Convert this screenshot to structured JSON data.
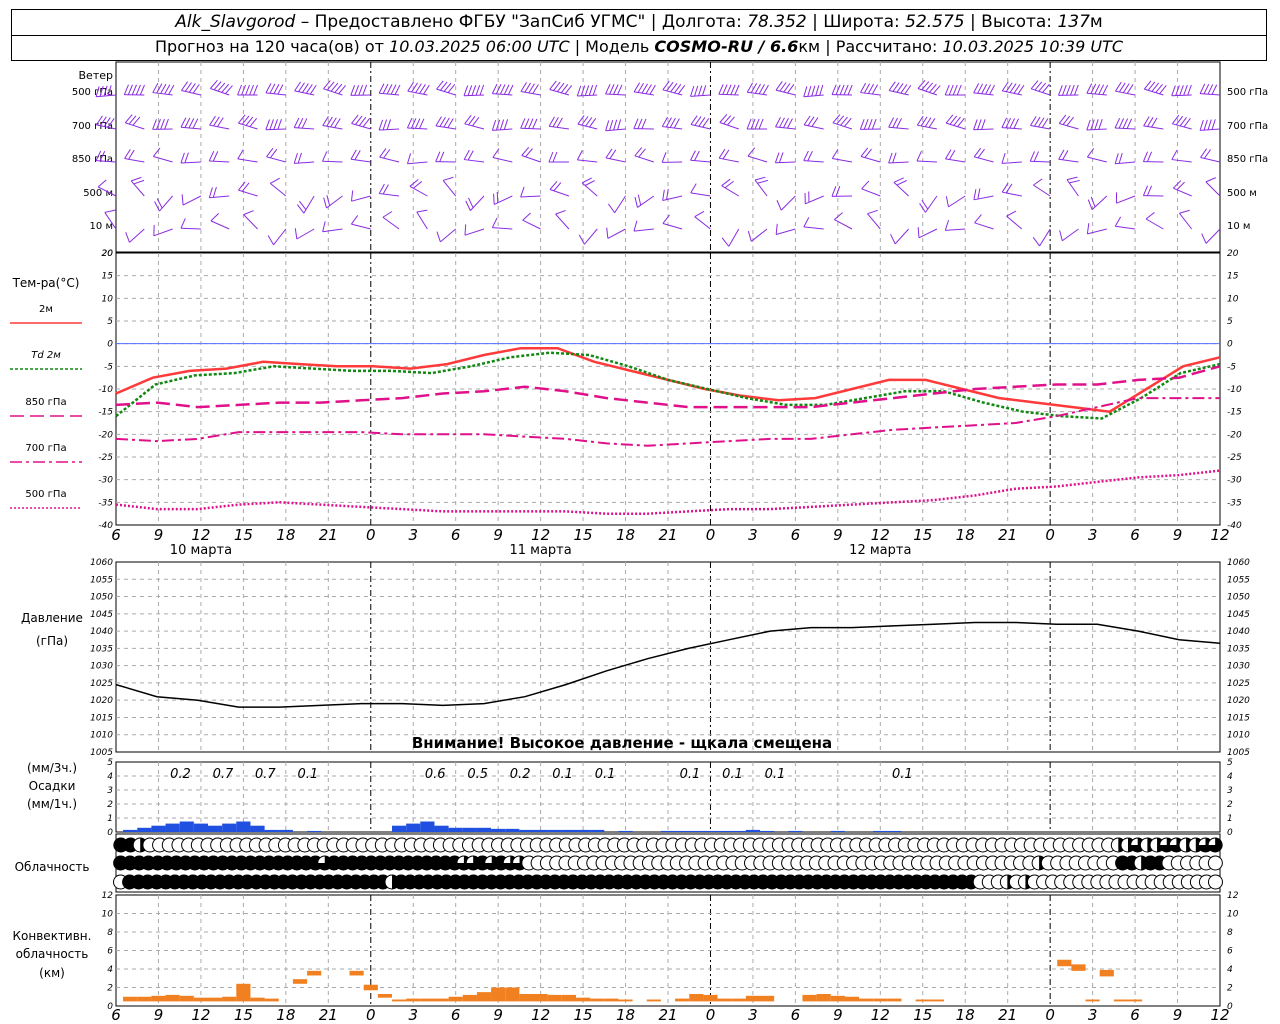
{
  "header": {
    "station": "Alk_Slavgorod",
    "provider": "Предоставлено ФГБУ \"ЗапСиб УГМС\"",
    "lon_label": "Долгота:",
    "lon": "78.352",
    "lat_label": "Широта:",
    "lat": "52.575",
    "alt_label": "Высота:",
    "alt": "137",
    "alt_unit": "м",
    "forecast_label": "Прогноз на 120 часа(ов) от",
    "forecast_time": "10.03.2025 06:00 UTC",
    "model_label": "Модель",
    "model": "COSMO-RU / 6.6",
    "model_unit": "км",
    "calc_label": "Рассчитано:",
    "calc_time": "10.03.2025 10:39 UTC"
  },
  "time_axis": {
    "hours": [
      "6",
      "9",
      "12",
      "15",
      "18",
      "21",
      "0",
      "3",
      "6",
      "9",
      "12",
      "15",
      "18",
      "21",
      "0",
      "3",
      "6",
      "9",
      "12",
      "15",
      "18",
      "21",
      "0",
      "3",
      "6",
      "9",
      "12"
    ],
    "dates": [
      "10 марта",
      "11 марта",
      "12 марта"
    ]
  },
  "wind_panel": {
    "title": "Ветер",
    "levels": [
      "500 гПа",
      "700 гПа",
      "850 гПа",
      "500 м",
      "10 м"
    ]
  },
  "colors": {
    "wind": "#8a2be2",
    "t2m": "#ff3a3a",
    "td2m": "#118811",
    "t850": "#e0108a",
    "t700": "#e0108a",
    "t500": "#e0108a",
    "pressure": "#000000",
    "precip": "#2050e0",
    "convective": "#f08020",
    "zero_line": "#5070ff"
  },
  "temp_panel": {
    "title": "Тем-ра(°C)",
    "legend": [
      "2м",
      "Td 2м",
      "850 гПа",
      "700 гПа",
      "500 гПа"
    ],
    "y_ticks": [
      "20",
      "15",
      "10",
      "5",
      "0",
      "-5",
      "-10",
      "-15",
      "-20",
      "-25",
      "-30",
      "-35",
      "-40"
    ]
  },
  "pressure_panel": {
    "title": "Давление",
    "unit": "(гПа)",
    "y_ticks": [
      "1060",
      "1055",
      "1050",
      "1045",
      "1040",
      "1035",
      "1030",
      "1025",
      "1020",
      "1015",
      "1010",
      "1005"
    ],
    "warning": "Внимание! Высокое давление - щкала смещена"
  },
  "precip_panel": {
    "unit_3h": "(мм/3ч.)",
    "title": "Осадки",
    "unit_1h": "(мм/1ч.)",
    "y_ticks": [
      "5",
      "4",
      "3",
      "2",
      "1",
      "0"
    ],
    "sum_labels": [
      {
        "t": 3,
        "v": "0.2"
      },
      {
        "t": 6,
        "v": "0.7"
      },
      {
        "t": 9,
        "v": "0.7"
      },
      {
        "t": 12,
        "v": "0.1"
      },
      {
        "t": 21,
        "v": "0.6"
      },
      {
        "t": 24,
        "v": "0.5"
      },
      {
        "t": 27,
        "v": "0.2"
      },
      {
        "t": 30,
        "v": "0.1"
      },
      {
        "t": 33,
        "v": "0.1"
      },
      {
        "t": 39,
        "v": "0.1"
      },
      {
        "t": 42,
        "v": "0.1"
      },
      {
        "t": 45,
        "v": "0.1"
      },
      {
        "t": 54,
        "v": "0.1"
      }
    ]
  },
  "cloud_panel": {
    "title": "Облачность"
  },
  "conv_panel": {
    "title1": "Конвективн.",
    "title2": "облачность",
    "unit": "(км)",
    "y_ticks": [
      "12",
      "10",
      "8",
      "6",
      "4",
      "2",
      "0"
    ]
  },
  "chart_data": {
    "type": "line",
    "x_unit": "hours since 10.03.2025 06:00 UTC",
    "x_range": [
      0,
      78
    ],
    "temperature": {
      "ylim": [
        -40,
        20
      ],
      "series": [
        {
          "name": "2м",
          "x": [
            0,
            3,
            6,
            9,
            12,
            15,
            18,
            21,
            24,
            27,
            30,
            33,
            36,
            39,
            42,
            45,
            48,
            51,
            54,
            57,
            60,
            63,
            66,
            69,
            72,
            75,
            78
          ],
          "values": [
            -11,
            -7.5,
            -6,
            -5.5,
            -4,
            -4.5,
            -5,
            -5,
            -5.5,
            -4.5,
            -2.5,
            -1,
            -1,
            -4,
            -6,
            -8,
            -10,
            -11.5,
            -12.5,
            -12,
            -10,
            -8,
            -8,
            -10,
            -12,
            -13,
            -14,
            -15,
            -10,
            -5,
            -3
          ]
        },
        {
          "name": "Td 2м",
          "x": [
            0,
            3,
            6,
            9,
            12,
            15,
            18,
            21,
            24,
            27,
            30,
            33,
            36,
            39,
            42,
            45,
            48,
            51,
            54,
            57,
            60,
            63,
            66,
            69,
            72,
            75,
            78
          ],
          "values": [
            -16,
            -9,
            -7,
            -6.5,
            -5,
            -5.5,
            -6,
            -6,
            -6.5,
            -5,
            -3,
            -2,
            -2.5,
            -5,
            -8,
            -10,
            -12,
            -13.5,
            -13.5,
            -12,
            -10.5,
            -10.5,
            -13,
            -15,
            -16,
            -16.5,
            -12,
            -6.5,
            -4.5
          ]
        },
        {
          "name": "850 гПа",
          "x": [
            0,
            3,
            6,
            9,
            12,
            15,
            18,
            21,
            24,
            27,
            30,
            33,
            36,
            39,
            42,
            45,
            48,
            51,
            54,
            57,
            60,
            63,
            66,
            69,
            72,
            75,
            78
          ],
          "values": [
            -13.5,
            -13,
            -14,
            -13.5,
            -13,
            -13,
            -12.5,
            -12,
            -11,
            -10.5,
            -9.5,
            -10.5,
            -12,
            -13,
            -14,
            -14,
            -14,
            -14,
            -13,
            -12,
            -11,
            -10,
            -9.5,
            -9,
            -9,
            -8,
            -7.5,
            -5
          ]
        },
        {
          "name": "700 гПа",
          "x": [
            0,
            3,
            6,
            9,
            12,
            15,
            18,
            21,
            24,
            27,
            30,
            33,
            36,
            39,
            42,
            45,
            48,
            51,
            54,
            57,
            60,
            63,
            66,
            69,
            72,
            75,
            78
          ],
          "values": [
            -21,
            -21.5,
            -21,
            -19.5,
            -19.5,
            -19.5,
            -19.5,
            -20,
            -20,
            -20,
            -20.5,
            -21,
            -22,
            -22.5,
            -22,
            -21.5,
            -21,
            -21,
            -20,
            -19,
            -18.5,
            -18,
            -17.5,
            -16,
            -14,
            -12,
            -12,
            -12
          ]
        },
        {
          "name": "500 гПа",
          "x": [
            0,
            3,
            6,
            9,
            12,
            15,
            18,
            21,
            24,
            27,
            30,
            33,
            36,
            39,
            42,
            45,
            48,
            51,
            54,
            57,
            60,
            63,
            66,
            69,
            72,
            75,
            78
          ],
          "values": [
            -35.5,
            -36.5,
            -36.5,
            -35.5,
            -35,
            -35.5,
            -36,
            -36.5,
            -37,
            -37,
            -37,
            -37,
            -37.5,
            -37.5,
            -37,
            -36.5,
            -36.5,
            -36,
            -35.5,
            -35,
            -34.5,
            -33.5,
            -32,
            -31.5,
            -30.5,
            -29.5,
            -29,
            -28
          ]
        }
      ]
    },
    "pressure": {
      "ylim": [
        1005,
        1060
      ],
      "x": [
        0,
        3,
        6,
        9,
        12,
        15,
        18,
        21,
        24,
        27,
        30,
        33,
        36,
        39,
        42,
        45,
        48,
        51,
        54,
        57,
        60,
        63,
        66,
        69,
        72,
        75,
        78
      ],
      "values": [
        1024.5,
        1021,
        1020,
        1018,
        1018,
        1018.5,
        1019,
        1019,
        1018.5,
        1019,
        1021,
        1024.5,
        1028.5,
        1032,
        1035,
        1037.5,
        1040,
        1041,
        1041,
        1041.5,
        1042,
        1042.5,
        1042.5,
        1042,
        1042,
        1040,
        1037.5,
        1036.5
      ]
    },
    "precipitation_mm_per_1h": {
      "ylim": [
        0,
        5
      ],
      "x": [
        1,
        2,
        3,
        4,
        5,
        6,
        7,
        8,
        9,
        10,
        11,
        12,
        14,
        20,
        21,
        22,
        23,
        24,
        25,
        26,
        27,
        28,
        29,
        30,
        31,
        32,
        33,
        34,
        36,
        39,
        40,
        41,
        42,
        43,
        44,
        45,
        46,
        48,
        51,
        54,
        55
      ],
      "values": [
        0.1,
        0.2,
        0.3,
        0.4,
        0.5,
        0.4,
        0.3,
        0.4,
        0.5,
        0.3,
        0.1,
        0.1,
        0.05,
        0.3,
        0.4,
        0.5,
        0.3,
        0.2,
        0.2,
        0.2,
        0.15,
        0.15,
        0.1,
        0.1,
        0.1,
        0.1,
        0.1,
        0.1,
        0.05,
        0.05,
        0.05,
        0.05,
        0.05,
        0.05,
        0.05,
        0.1,
        0.05,
        0.05,
        0.05,
        0.05,
        0.05
      ]
    },
    "cloud_cover_okta": {
      "rows": [
        "high",
        "middle",
        "low"
      ],
      "high": [
        8,
        8,
        4,
        0,
        0,
        0,
        0,
        0,
        0,
        0,
        0,
        0,
        0,
        0,
        0,
        0,
        0,
        0,
        0,
        0,
        0,
        0,
        0,
        0,
        0,
        0,
        0,
        0,
        0,
        0,
        0,
        0,
        0,
        0,
        0,
        0,
        0,
        0,
        0,
        0,
        0,
        0,
        0,
        0,
        0,
        0,
        0,
        0,
        0,
        0,
        0,
        0,
        0,
        0,
        0,
        0,
        0,
        0,
        0,
        0,
        0,
        0,
        0,
        0,
        0,
        0,
        0,
        0,
        0,
        0,
        0,
        0,
        0,
        0,
        0,
        0,
        0,
        0,
        0,
        0,
        0,
        0,
        0,
        0,
        0,
        0,
        0,
        0,
        0,
        0,
        0,
        0,
        0,
        0,
        0,
        0,
        0,
        0,
        0,
        0,
        0,
        0,
        0,
        4,
        4,
        6,
        4,
        4,
        6,
        6,
        4,
        4,
        6,
        6
      ],
      "middle": [
        8,
        8,
        8,
        8,
        8,
        8,
        8,
        8,
        8,
        8,
        8,
        8,
        8,
        8,
        8,
        8,
        8,
        8,
        8,
        8,
        8,
        8,
        6,
        8,
        8,
        8,
        8,
        8,
        8,
        8,
        8,
        8,
        8,
        8,
        8,
        8,
        8,
        6,
        6,
        8,
        6,
        8,
        6,
        6,
        0,
        0,
        0,
        0,
        0,
        0,
        0,
        0,
        0,
        0,
        0,
        0,
        0,
        0,
        0,
        0,
        0,
        0,
        0,
        0,
        0,
        0,
        0,
        0,
        0,
        0,
        0,
        0,
        0,
        0,
        0,
        0,
        0,
        0,
        0,
        0,
        0,
        0,
        0,
        0,
        0,
        0,
        0,
        0,
        0,
        0,
        0,
        0,
        0,
        0,
        0,
        0,
        0,
        0,
        0,
        4,
        0,
        0,
        0,
        0,
        0,
        0,
        0,
        0,
        8,
        8,
        4,
        8,
        8,
        0,
        0,
        0,
        0,
        0,
        0
      ],
      "low": [
        0,
        8,
        8,
        8,
        8,
        8,
        8,
        8,
        8,
        8,
        8,
        8,
        8,
        8,
        8,
        8,
        8,
        8,
        8,
        8,
        8,
        8,
        8,
        8,
        8,
        8,
        8,
        8,
        8,
        8,
        4,
        8,
        8,
        8,
        8,
        8,
        8,
        8,
        8,
        8,
        8,
        8,
        8,
        8,
        8,
        8,
        8,
        8,
        8,
        8,
        8,
        8,
        8,
        8,
        8,
        8,
        8,
        8,
        8,
        8,
        8,
        8,
        8,
        8,
        8,
        8,
        8,
        8,
        8,
        8,
        8,
        8,
        8,
        8,
        8,
        8,
        8,
        8,
        8,
        8,
        8,
        8,
        8,
        8,
        8,
        8,
        8,
        8,
        8,
        8,
        8,
        8,
        8,
        8,
        8,
        0,
        0,
        0,
        4,
        0,
        4,
        0,
        0,
        0,
        0,
        0,
        0,
        0,
        0,
        0,
        0,
        0,
        0,
        0,
        0,
        0,
        0,
        0,
        0,
        0,
        0,
        0
      ]
    },
    "convective_cloud_km": {
      "ylim": [
        0,
        12
      ],
      "bars": [
        {
          "x": 1,
          "base": 0.5,
          "top": 1.0
        },
        {
          "x": 2,
          "base": 0.5,
          "top": 1.0
        },
        {
          "x": 3,
          "base": 0.5,
          "top": 1.1
        },
        {
          "x": 4,
          "base": 0.5,
          "top": 1.2
        },
        {
          "x": 5,
          "base": 0.5,
          "top": 1.1
        },
        {
          "x": 6,
          "base": 0.5,
          "top": 0.9
        },
        {
          "x": 7,
          "base": 0.5,
          "top": 0.9
        },
        {
          "x": 8,
          "base": 0.5,
          "top": 1.0
        },
        {
          "x": 9,
          "base": 0.5,
          "top": 2.4
        },
        {
          "x": 10,
          "base": 0.5,
          "top": 0.9
        },
        {
          "x": 11,
          "base": 0.5,
          "top": 0.8
        },
        {
          "x": 13,
          "base": 2.4,
          "top": 2.9
        },
        {
          "x": 14,
          "base": 3.3,
          "top": 3.8
        },
        {
          "x": 17,
          "base": 3.3,
          "top": 3.8
        },
        {
          "x": 18,
          "base": 1.7,
          "top": 2.3
        },
        {
          "x": 19,
          "base": 0.9,
          "top": 1.3
        },
        {
          "x": 20,
          "base": 0.5,
          "top": 0.7
        },
        {
          "x": 21,
          "base": 0.5,
          "top": 0.8
        },
        {
          "x": 22,
          "base": 0.5,
          "top": 0.8
        },
        {
          "x": 23,
          "base": 0.5,
          "top": 0.8
        },
        {
          "x": 24,
          "base": 0.5,
          "top": 1.0
        },
        {
          "x": 25,
          "base": 0.5,
          "top": 1.2
        },
        {
          "x": 26,
          "base": 0.5,
          "top": 1.5
        },
        {
          "x": 27,
          "base": 0.5,
          "top": 2.0
        },
        {
          "x": 28,
          "base": 0.5,
          "top": 2.0
        },
        {
          "x": 29,
          "base": 0.5,
          "top": 1.3
        },
        {
          "x": 30,
          "base": 0.5,
          "top": 1.3
        },
        {
          "x": 31,
          "base": 0.5,
          "top": 1.2
        },
        {
          "x": 32,
          "base": 0.5,
          "top": 1.2
        },
        {
          "x": 33,
          "base": 0.5,
          "top": 0.9
        },
        {
          "x": 34,
          "base": 0.5,
          "top": 0.8
        },
        {
          "x": 35,
          "base": 0.5,
          "top": 0.8
        },
        {
          "x": 36,
          "base": 0.5,
          "top": 0.7
        },
        {
          "x": 38,
          "base": 0.5,
          "top": 0.7
        },
        {
          "x": 40,
          "base": 0.5,
          "top": 0.8
        },
        {
          "x": 41,
          "base": 0.5,
          "top": 1.3
        },
        {
          "x": 42,
          "base": 0.5,
          "top": 1.2
        },
        {
          "x": 43,
          "base": 0.5,
          "top": 0.8
        },
        {
          "x": 44,
          "base": 0.5,
          "top": 0.8
        },
        {
          "x": 45,
          "base": 0.5,
          "top": 1.1
        },
        {
          "x": 46,
          "base": 0.5,
          "top": 1.1
        },
        {
          "x": 49,
          "base": 0.5,
          "top": 1.2
        },
        {
          "x": 50,
          "base": 0.5,
          "top": 1.3
        },
        {
          "x": 51,
          "base": 0.5,
          "top": 1.1
        },
        {
          "x": 52,
          "base": 0.5,
          "top": 1.0
        },
        {
          "x": 53,
          "base": 0.5,
          "top": 0.8
        },
        {
          "x": 54,
          "base": 0.5,
          "top": 0.8
        },
        {
          "x": 55,
          "base": 0.5,
          "top": 0.8
        },
        {
          "x": 57,
          "base": 0.5,
          "top": 0.7
        },
        {
          "x": 58,
          "base": 0.5,
          "top": 0.7
        },
        {
          "x": 67,
          "base": 4.3,
          "top": 5.0
        },
        {
          "x": 68,
          "base": 3.8,
          "top": 4.5
        },
        {
          "x": 69,
          "base": 0.5,
          "top": 0.7
        },
        {
          "x": 70,
          "base": 3.2,
          "top": 3.9
        },
        {
          "x": 71,
          "base": 0.5,
          "top": 0.7
        },
        {
          "x": 72,
          "base": 0.5,
          "top": 0.7
        }
      ]
    }
  }
}
